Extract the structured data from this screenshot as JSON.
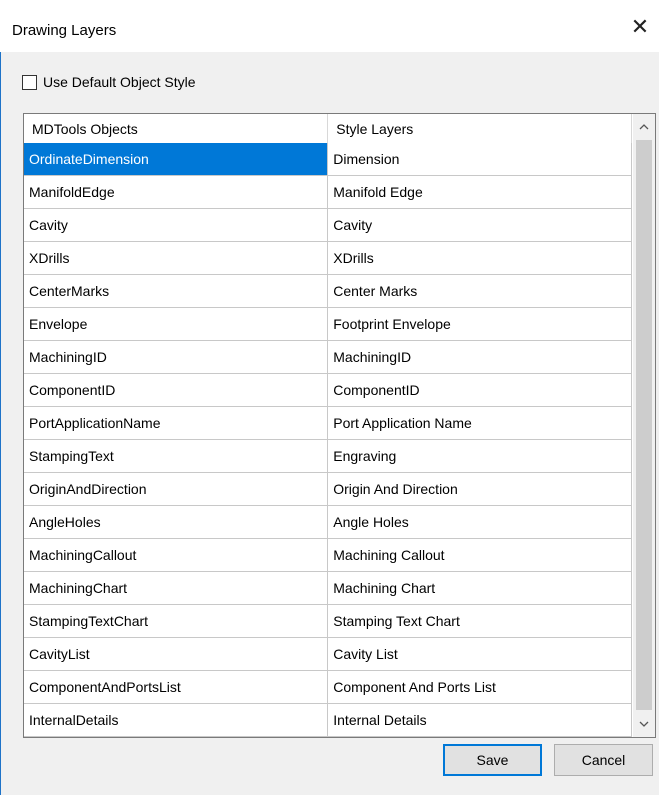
{
  "window": {
    "title": "Drawing Layers",
    "close_glyph": "✕"
  },
  "options": {
    "use_default_label": "Use Default Object Style",
    "use_default_checked": false
  },
  "grid": {
    "headers": [
      "MDTools Objects",
      "Style Layers"
    ],
    "selected_index": 0,
    "rows": [
      [
        "OrdinateDimension",
        "Dimension"
      ],
      [
        "ManifoldEdge",
        "Manifold Edge"
      ],
      [
        "Cavity",
        "Cavity"
      ],
      [
        "XDrills",
        "XDrills"
      ],
      [
        "CenterMarks",
        "Center Marks"
      ],
      [
        "Envelope",
        "Footprint Envelope"
      ],
      [
        "MachiningID",
        "MachiningID"
      ],
      [
        "ComponentID",
        "ComponentID"
      ],
      [
        "PortApplicationName",
        "Port Application Name"
      ],
      [
        "StampingText",
        "Engraving"
      ],
      [
        "OriginAndDirection",
        "Origin And Direction"
      ],
      [
        "AngleHoles",
        "Angle Holes"
      ],
      [
        "MachiningCallout",
        "Machining Callout"
      ],
      [
        "MachiningChart",
        "Machining Chart"
      ],
      [
        "StampingTextChart",
        "Stamping Text Chart"
      ],
      [
        "CavityList",
        "Cavity List"
      ],
      [
        "ComponentAndPortsList",
        "Component And Ports List"
      ],
      [
        "InternalDetails",
        "Internal Details"
      ]
    ]
  },
  "scrollbar": {
    "up_icon": "chevron-up-icon",
    "down_icon": "chevron-down-icon"
  },
  "buttons": {
    "save": "Save",
    "cancel": "Cancel"
  },
  "colors": {
    "selection": "#0078d7",
    "default_button_border": "#0078d7"
  }
}
